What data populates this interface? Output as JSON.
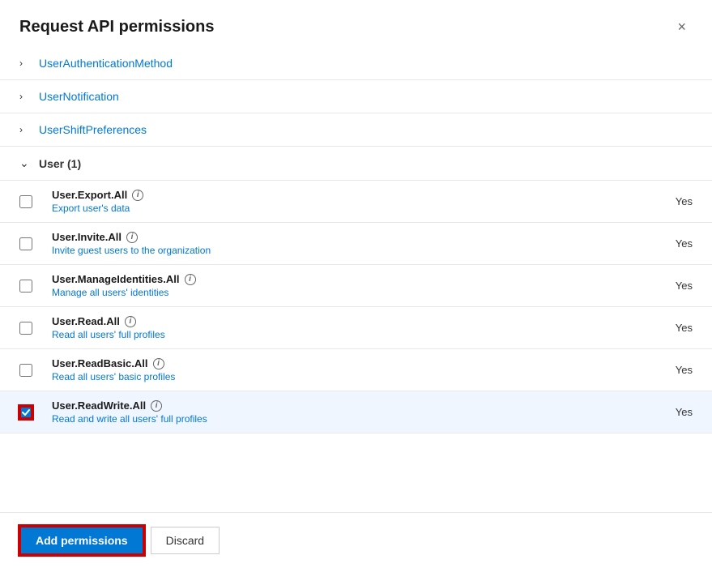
{
  "dialog": {
    "title": "Request API permissions",
    "close_label": "×"
  },
  "collapsed_sections": [
    {
      "name": "UserAuthenticationMethod"
    },
    {
      "name": "UserNotification"
    },
    {
      "name": "UserShiftPreferences"
    }
  ],
  "expanded_section": {
    "label": "User (1)"
  },
  "permissions": [
    {
      "id": "user-export-all",
      "name": "User.Export.All",
      "description": "Export user's data",
      "consent": "Yes",
      "checked": false
    },
    {
      "id": "user-invite-all",
      "name": "User.Invite.All",
      "description": "Invite guest users to the organization",
      "consent": "Yes",
      "checked": false
    },
    {
      "id": "user-manage-identities",
      "name": "User.ManageIdentities.All",
      "description": "Manage all users' identities",
      "consent": "Yes",
      "checked": false
    },
    {
      "id": "user-read-all",
      "name": "User.Read.All",
      "description": "Read all users' full profiles",
      "consent": "Yes",
      "checked": false
    },
    {
      "id": "user-readbasic-all",
      "name": "User.ReadBasic.All",
      "description": "Read all users' basic profiles",
      "consent": "Yes",
      "checked": false
    },
    {
      "id": "user-readwrite-all",
      "name": "User.ReadWrite.All",
      "description": "Read and write all users' full profiles",
      "consent": "Yes",
      "checked": true
    }
  ],
  "footer": {
    "add_label": "Add permissions",
    "discard_label": "Discard"
  },
  "icons": {
    "chevron_right": "›",
    "chevron_down": "∨",
    "info": "i",
    "check": "✓"
  }
}
